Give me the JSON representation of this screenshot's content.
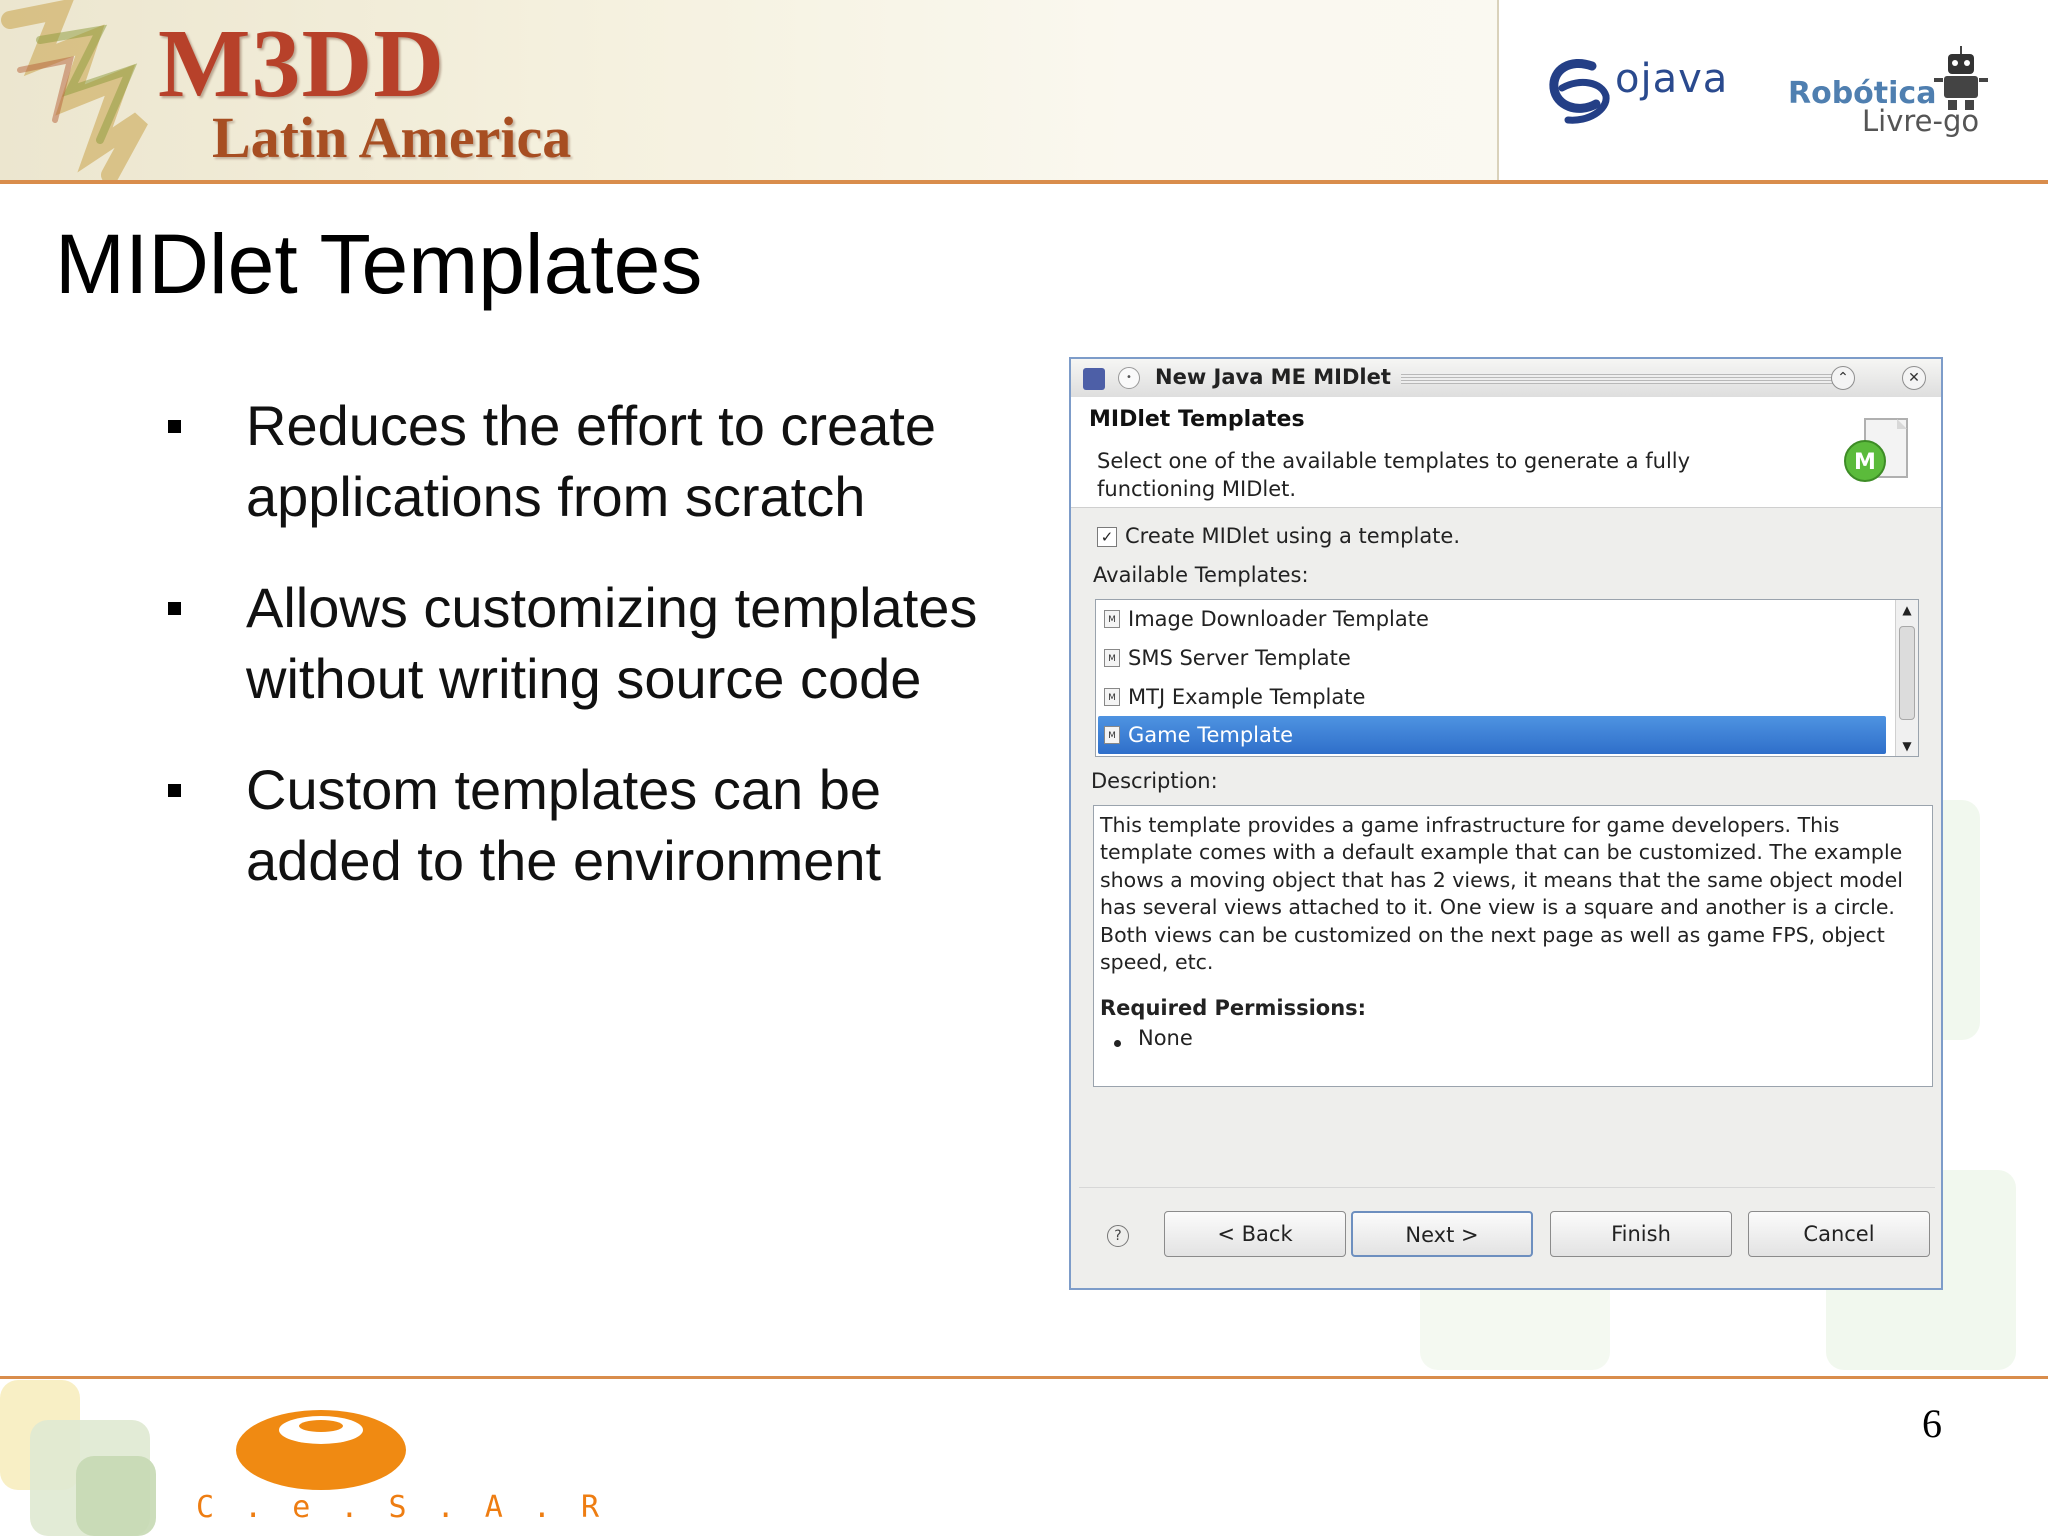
{
  "header": {
    "logo_main": "M3DD",
    "logo_sub": "Latin America",
    "partner1": "ojava",
    "partner1_icon": "ojava-swirl-icon",
    "partner2_line1": "Robótica",
    "partner2_line2": "Livre-go",
    "partner2_icon": "robot-icon"
  },
  "slide": {
    "title": "MIDlet Templates",
    "bullets": [
      "Reduces the effort to create applications from scratch",
      "Allows customizing templates without writing source code",
      "Custom templates can be added to the environment"
    ]
  },
  "dialog": {
    "window_title": "New Java ME MIDlet",
    "page_title": "MIDlet Templates",
    "page_description": "Select one of the available templates to generate a fully functioning MIDlet.",
    "checkbox_label": "Create MIDlet using a template.",
    "checkbox_checked": true,
    "available_label": "Available Templates:",
    "templates": [
      "Image Downloader Template",
      "SMS Server Template",
      "MTJ Example Template",
      "Game Template"
    ],
    "selected_template": "Game Template",
    "description_label": "Description:",
    "description_text": "This template provides a game infrastructure for game developers. This template comes with a default example that can be customized. The example shows a moving object that has 2 views, it means that the same object model has several views attached to it. One view is a square and another is a circle. Both views can be customized on the next page as well as game FPS, object speed, etc.",
    "permissions_title": "Required Permissions:",
    "permissions": [
      "None"
    ],
    "buttons": {
      "back": "< Back",
      "next": "Next >",
      "finish": "Finish",
      "cancel": "Cancel"
    },
    "icons": {
      "app": "app-icon",
      "wizard": "midlet-wizard-icon",
      "help": "help-icon",
      "template": "template-file-icon"
    },
    "selection_color": "#3a7fd5"
  },
  "footer": {
    "page_number": "6",
    "org": "C.e.S.A.R",
    "org_letters": "C . e . S . A . R",
    "brand_color": "#ee7d12"
  }
}
